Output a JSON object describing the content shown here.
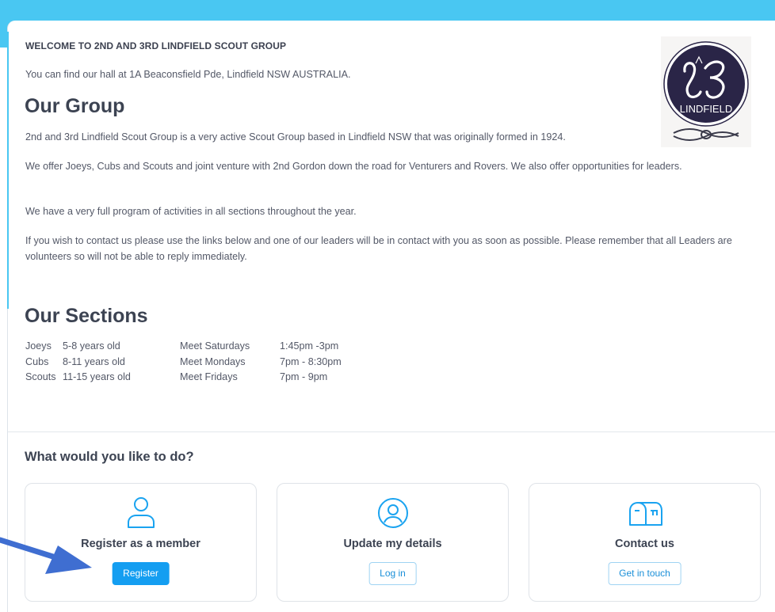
{
  "welcome": "WELCOME TO 2ND AND 3RD LINDFIELD SCOUT GROUP",
  "address": "You can find our hall at 1A Beaconsfield Pde, Lindfield NSW AUSTRALIA.",
  "logo_text": "LINDFIELD",
  "group": {
    "heading": "Our Group",
    "paragraphs": [
      "2nd and 3rd Lindfield Scout Group is a very active Scout Group based in Lindfield NSW that was originally formed in 1924.",
      "We offer Joeys, Cubs and Scouts and joint venture with 2nd Gordon down the road for Venturers and Rovers. We also offer opportunities for leaders.",
      "We have a very full program of activities in all sections throughout the year.",
      "If you wish to contact us please use the links below and one of our leaders will be in contact with you as soon as possible. Please remember that all Leaders are volunteers so will not be able to reply immediately."
    ]
  },
  "sections": {
    "heading": "Our Sections",
    "rows": [
      {
        "name": "Joeys",
        "ages": "5-8 years old",
        "day": "Meet Saturdays",
        "time": "1:45pm -3pm"
      },
      {
        "name": "Cubs",
        "ages": "8-11 years old",
        "day": "Meet Mondays",
        "time": "7pm - 8:30pm"
      },
      {
        "name": "Scouts",
        "ages": "11-15 years old",
        "day": "Meet Fridays",
        "time": "7pm - 9pm"
      }
    ]
  },
  "actions": {
    "heading": "What would you like to do?",
    "items": [
      {
        "icon": "user-icon",
        "title": "Register as a member",
        "button": "Register"
      },
      {
        "icon": "user-circle-icon",
        "title": "Update my details",
        "button": "Log in"
      },
      {
        "icon": "mailbox-icon",
        "title": "Contact us",
        "button": "Get in touch"
      }
    ]
  },
  "colors": {
    "accent": "#49c7f2",
    "primary_button": "#149ef1",
    "icon": "#1aa3f0",
    "arrow": "#3f6ed1",
    "logo_bg": "#2a2547"
  }
}
